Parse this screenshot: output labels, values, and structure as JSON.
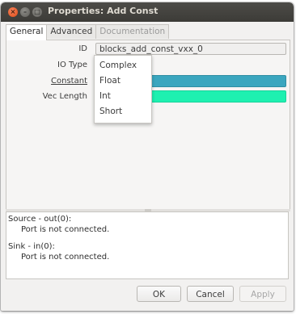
{
  "window": {
    "title": "Properties: Add Const",
    "controls": {
      "close": "×",
      "minimize": "–",
      "maximize": "□"
    }
  },
  "tabs": [
    {
      "label": "General",
      "active": true
    },
    {
      "label": "Advanced",
      "active": false
    },
    {
      "label": "Documentation",
      "active": false,
      "disabled": true
    }
  ],
  "properties": {
    "id": {
      "label": "ID",
      "value": "blocks_add_const_vxx_0"
    },
    "io_type": {
      "label": "IO Type",
      "selected": "Complex",
      "options": [
        "Complex",
        "Float",
        "Int",
        "Short"
      ]
    },
    "constant": {
      "label": "Constant",
      "value": "",
      "color": "#3ba6bf"
    },
    "vec_length": {
      "label": "Vec Length",
      "value": "",
      "color": "#1ef0b0"
    }
  },
  "console": {
    "source_header": "Source - out(0):",
    "source_msg": "Port is not connected.",
    "sink_header": "Sink - in(0):",
    "sink_msg": "Port is not connected."
  },
  "buttons": {
    "ok": "OK",
    "cancel": "Cancel",
    "apply": "Apply"
  }
}
